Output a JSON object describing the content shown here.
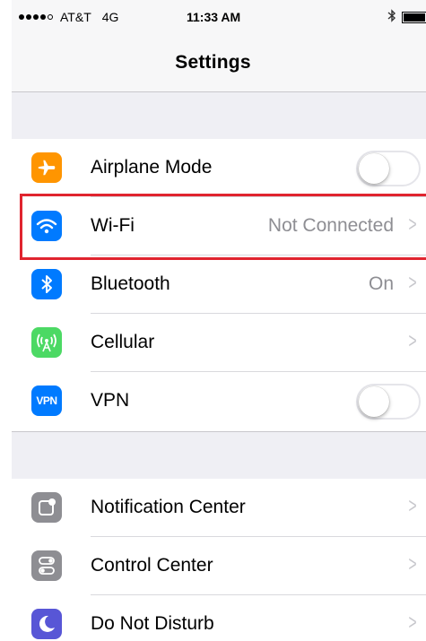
{
  "status_bar": {
    "carrier": "AT&T",
    "network": "4G",
    "time": "11:33 AM",
    "signal_bars_filled": 4,
    "signal_bars_total": 5
  },
  "nav": {
    "title": "Settings"
  },
  "group1": [
    {
      "label": "Airplane Mode",
      "icon": "airplane-icon",
      "icon_color": "#ff9500",
      "control": "toggle",
      "toggle_on": false
    },
    {
      "label": "Wi-Fi",
      "icon": "wifi-icon",
      "icon_color": "#007aff",
      "value": "Not Connected",
      "control": "chevron"
    },
    {
      "label": "Bluetooth",
      "icon": "bluetooth-icon",
      "icon_color": "#007aff",
      "value": "On",
      "control": "chevron"
    },
    {
      "label": "Cellular",
      "icon": "cellular-icon",
      "icon_color": "#4cd964",
      "control": "chevron"
    },
    {
      "label": "VPN",
      "icon": "vpn-icon",
      "icon_text": "VPN",
      "icon_color": "#007aff",
      "control": "toggle",
      "toggle_on": false
    }
  ],
  "group2": [
    {
      "label": "Notification Center",
      "icon": "notification-center-icon",
      "icon_color": "#8e8e93",
      "control": "chevron"
    },
    {
      "label": "Control Center",
      "icon": "control-center-icon",
      "icon_color": "#8e8e93",
      "control": "chevron"
    },
    {
      "label": "Do Not Disturb",
      "icon": "moon-icon",
      "icon_color": "#5856d6",
      "control": "chevron"
    }
  ],
  "chevron_glyph": ">",
  "highlight_color": "#e0242f"
}
